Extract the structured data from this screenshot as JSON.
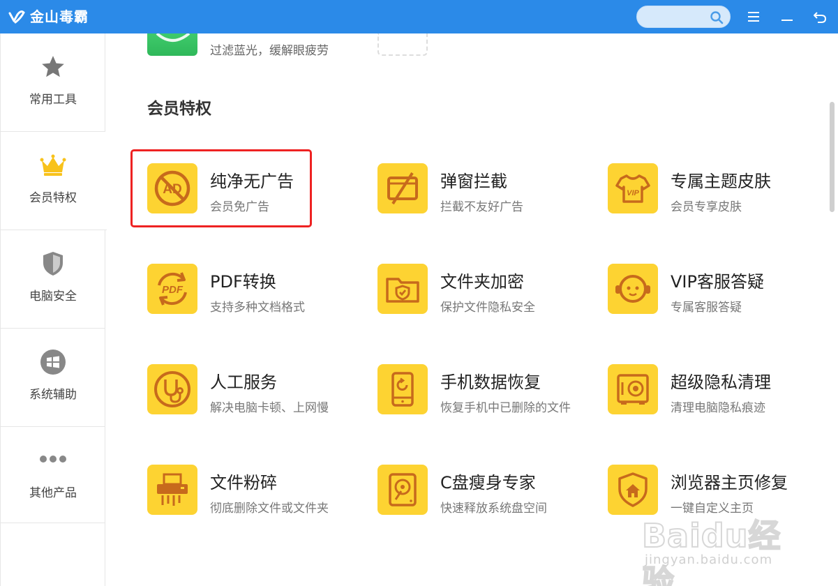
{
  "window": {
    "title": "金山毒霸",
    "search_placeholder": ""
  },
  "sidebar": {
    "items": [
      {
        "label": "常用工具",
        "icon": "star-icon"
      },
      {
        "label": "会员特权",
        "icon": "crown-icon",
        "active": true
      },
      {
        "label": "电脑安全",
        "icon": "shield-icon"
      },
      {
        "label": "系统辅助",
        "icon": "windows-icon"
      },
      {
        "label": "其他产品",
        "icon": "more-dots-icon"
      }
    ]
  },
  "partial_tool": {
    "desc": "过滤蓝光，缓解眼疲劳"
  },
  "section": {
    "title": "会员特权"
  },
  "tools": [
    {
      "name": "纯净无广告",
      "desc": "会员免广告",
      "icon": "no-ad-icon"
    },
    {
      "name": "弹窗拦截",
      "desc": "拦截不友好广告",
      "icon": "popup-block-icon"
    },
    {
      "name": "专属主题皮肤",
      "desc": "会员专享皮肤",
      "icon": "vip-tshirt-icon"
    },
    {
      "name": "PDF转换",
      "desc": "支持多种文档格式",
      "icon": "pdf-convert-icon"
    },
    {
      "name": "文件夹加密",
      "desc": "保护文件隐私安全",
      "icon": "folder-lock-icon"
    },
    {
      "name": "VIP客服答疑",
      "desc": "专属客服答疑",
      "icon": "support-face-icon"
    },
    {
      "name": "人工服务",
      "desc": "解决电脑卡顿、上网慢",
      "icon": "stethoscope-icon"
    },
    {
      "name": "手机数据恢复",
      "desc": "恢复手机中已删除的文件",
      "icon": "phone-restore-icon"
    },
    {
      "name": "超级隐私清理",
      "desc": "清理电脑隐私痕迹",
      "icon": "safe-icon"
    },
    {
      "name": "文件粉碎",
      "desc": "彻底删除文件或文件夹",
      "icon": "shredder-icon"
    },
    {
      "name": "C盘瘦身专家",
      "desc": "快速释放系统盘空间",
      "icon": "disk-icon"
    },
    {
      "name": "浏览器主页修复",
      "desc": "一键自定义主页",
      "icon": "home-shield-icon"
    }
  ],
  "watermark": {
    "brand": "Baidu经验",
    "url": "jingyan.baidu.com"
  },
  "colors": {
    "titlebar": "#2b8ae8",
    "icon_bg": "#fdd332",
    "icon_fg": "#c76a1c",
    "highlight": "#ee2222"
  }
}
